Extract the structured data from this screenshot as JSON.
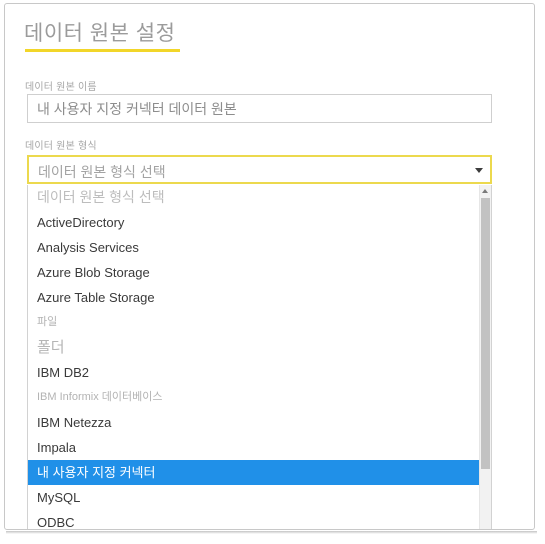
{
  "page": {
    "title": "데이터 원본 설정"
  },
  "fields": {
    "name": {
      "label": "데이터 원본 이름",
      "value": "내 사용자 지정 커넥터 데이터 원본",
      "placeholder": "데이터 원본 이름"
    },
    "type": {
      "label": "데이터 원본 형식",
      "selected_value": "데이터 원본 형식 선택"
    }
  },
  "dropdown": {
    "open": true,
    "selected_index": 11,
    "options": [
      {
        "label": "데이터 원본 형식 선택",
        "style": "placeholder"
      },
      {
        "label": "ActiveDirectory",
        "style": "normal"
      },
      {
        "label": "Analysis Services",
        "style": "normal"
      },
      {
        "label": "Azure Blob Storage",
        "style": "normal"
      },
      {
        "label": "Azure Table Storage",
        "style": "normal"
      },
      {
        "label": "파일",
        "style": "muted-small"
      },
      {
        "label": "폴더",
        "style": "muted-large"
      },
      {
        "label": "IBM DB2",
        "style": "normal"
      },
      {
        "label": "IBM Informix 데이터베이스",
        "style": "muted-small"
      },
      {
        "label": "IBM Netezza",
        "style": "normal"
      },
      {
        "label": "Impala",
        "style": "normal"
      },
      {
        "label": "내 사용자 지정 커넥터",
        "style": "selected"
      },
      {
        "label": "MySQL",
        "style": "normal"
      },
      {
        "label": "ODBC",
        "style": "normal"
      }
    ],
    "scrollbar": {
      "up_arrow_icon": "caret-up-icon"
    }
  },
  "icons": {
    "dropdown_arrow": "chevron-down-icon"
  },
  "colors": {
    "accent_yellow": "#f2d629",
    "select_border_yellow": "#ecd94e",
    "selection_blue": "#2090e8",
    "label_grey": "#a6a6a6",
    "text_grey": "#3a3a3a",
    "frame_border": "#c8c8c8"
  }
}
